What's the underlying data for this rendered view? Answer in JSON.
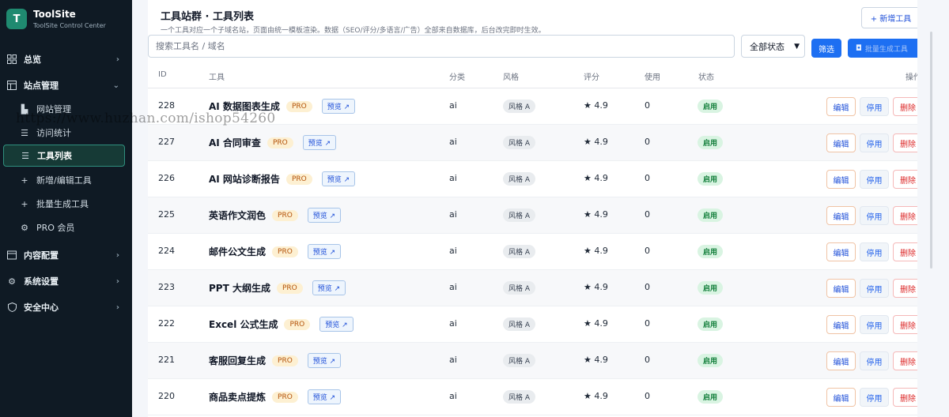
{
  "brand": {
    "logo_letter": "T",
    "name": "ToolSite",
    "subtitle": "ToolSite Control Center"
  },
  "sidebar": {
    "groups": [
      {
        "label": "总览",
        "icon": "grid-icon"
      },
      {
        "label": "站点管理",
        "icon": "layout-icon"
      },
      {
        "label": "内容配置",
        "icon": "content-icon"
      },
      {
        "label": "系统设置",
        "icon": "gear-icon"
      },
      {
        "label": "安全中心",
        "icon": "shield-icon"
      }
    ],
    "sub_items": [
      {
        "label": "网站管理",
        "icon": "site-icon"
      },
      {
        "label": "访问统计",
        "icon": "list-icon"
      },
      {
        "label": "工具列表",
        "icon": "list-icon",
        "active": true
      },
      {
        "label": "新增/编辑工具",
        "icon": "plus-icon"
      },
      {
        "label": "批量生成工具",
        "icon": "plus-icon"
      },
      {
        "label": "PRO 会员",
        "icon": "gear-icon"
      }
    ]
  },
  "header": {
    "title": "工具站群 · 工具列表",
    "subtitle": "一个工具对应一个子域名站，页面由统一模板渲染。数据（SEO/评分/多语言/广告）全部来自数据库，后台改完即时生效。",
    "add_button": "+ 新增工具"
  },
  "toolbar": {
    "search_placeholder": "搜索工具名 / 域名",
    "status_select": "全部状态",
    "filter_button": "筛选",
    "batch_button": "批量生成工具"
  },
  "table": {
    "columns": [
      "ID",
      "工具",
      "分类",
      "风格",
      "评分",
      "使用",
      "状态",
      "操作"
    ],
    "rows": [
      {
        "id": "228",
        "name": "AI 数据图表生成",
        "pro": "PRO",
        "preview": "预览 ↗",
        "category": "ai",
        "style": "风格 A",
        "score": "★ 4.9",
        "uses": "0",
        "status": "启用"
      },
      {
        "id": "227",
        "name": "AI 合同审查",
        "pro": "PRO",
        "preview": "预览 ↗",
        "category": "ai",
        "style": "风格 A",
        "score": "★ 4.9",
        "uses": "0",
        "status": "启用"
      },
      {
        "id": "226",
        "name": "AI 网站诊断报告",
        "pro": "PRO",
        "preview": "预览 ↗",
        "category": "ai",
        "style": "风格 A",
        "score": "★ 4.9",
        "uses": "0",
        "status": "启用"
      },
      {
        "id": "225",
        "name": "英语作文润色",
        "pro": "PRO",
        "preview": "预览 ↗",
        "category": "ai",
        "style": "风格 A",
        "score": "★ 4.9",
        "uses": "0",
        "status": "启用"
      },
      {
        "id": "224",
        "name": "邮件公文生成",
        "pro": "PRO",
        "preview": "预览 ↗",
        "category": "ai",
        "style": "风格 A",
        "score": "★ 4.9",
        "uses": "0",
        "status": "启用"
      },
      {
        "id": "223",
        "name": "PPT 大纲生成",
        "pro": "PRO",
        "preview": "预览 ↗",
        "category": "ai",
        "style": "风格 A",
        "score": "★ 4.9",
        "uses": "0",
        "status": "启用"
      },
      {
        "id": "222",
        "name": "Excel 公式生成",
        "pro": "PRO",
        "preview": "预览 ↗",
        "category": "ai",
        "style": "风格 A",
        "score": "★ 4.9",
        "uses": "0",
        "status": "启用"
      },
      {
        "id": "221",
        "name": "客服回复生成",
        "pro": "PRO",
        "preview": "预览 ↗",
        "category": "ai",
        "style": "风格 A",
        "score": "★ 4.9",
        "uses": "0",
        "status": "启用"
      },
      {
        "id": "220",
        "name": "商品卖点提炼",
        "pro": "PRO",
        "preview": "预览 ↗",
        "category": "ai",
        "style": "风格 A",
        "score": "★ 4.9",
        "uses": "0",
        "status": "启用"
      }
    ],
    "actions": {
      "edit": "编辑",
      "disable": "停用",
      "delete": "删除"
    }
  },
  "watermark": "https://www.huzhan.com/ishop54260",
  "colors": {
    "sidebar_bg": "#0f1a24",
    "accent": "#1d6ff2",
    "brand": "#1f8a70",
    "status_green": "#15803d"
  }
}
